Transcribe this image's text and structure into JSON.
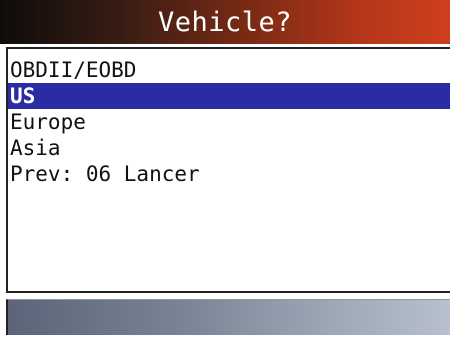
{
  "header": {
    "title": "Vehicle?"
  },
  "menu": {
    "items": [
      {
        "label": "OBDII/EOBD",
        "selected": false
      },
      {
        "label": "US",
        "selected": true
      },
      {
        "label": "Europe",
        "selected": false
      },
      {
        "label": "Asia",
        "selected": false
      },
      {
        "label": "Prev: 06 Lancer",
        "selected": false
      }
    ]
  },
  "colors": {
    "title_bar_start": "#0e0c0b",
    "title_bar_end": "#cf3f1d",
    "selection": "#2a2ca6",
    "footer_start": "#5b6478",
    "footer_end": "#b7c0cc"
  }
}
